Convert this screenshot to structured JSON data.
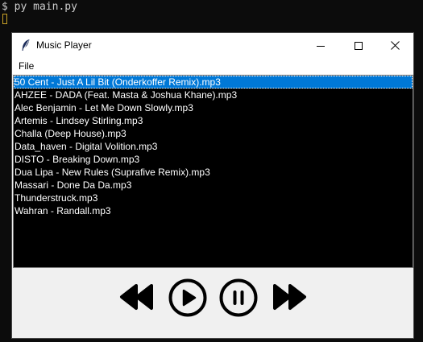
{
  "terminal": {
    "prompt": "$",
    "command": "py main.py"
  },
  "window": {
    "title": "Music Player",
    "icon": "feather-icon",
    "controls": [
      "minimize-icon",
      "maximize-icon",
      "close-icon"
    ]
  },
  "menu": {
    "items": [
      {
        "label": "File"
      }
    ]
  },
  "playlist": {
    "selected_index": 0,
    "selection_color": "#0078d7",
    "items": [
      {
        "label": "50 Cent - Just A Lil Bit (Onderkoffer Remix).mp3"
      },
      {
        "label": "AHZEE - DADA (Feat. Masta & Joshua Khane).mp3"
      },
      {
        "label": "Alec Benjamin - Let Me Down Slowly.mp3"
      },
      {
        "label": "Artemis - Lindsey Stirling.mp3"
      },
      {
        "label": "Challa (Deep House).mp3"
      },
      {
        "label": "Data_haven - Digital Volition.mp3"
      },
      {
        "label": "DISTO - Breaking Down.mp3"
      },
      {
        "label": "Dua Lipa - New Rules (Suprafive Remix).mp3"
      },
      {
        "label": "Massari - Done Da Da.mp3"
      },
      {
        "label": "Thunderstruck.mp3"
      },
      {
        "label": "Wahran - Randall.mp3"
      }
    ]
  },
  "controls": {
    "buttons": [
      "rewind-icon",
      "play-icon",
      "pause-icon",
      "fast-forward-icon"
    ]
  }
}
